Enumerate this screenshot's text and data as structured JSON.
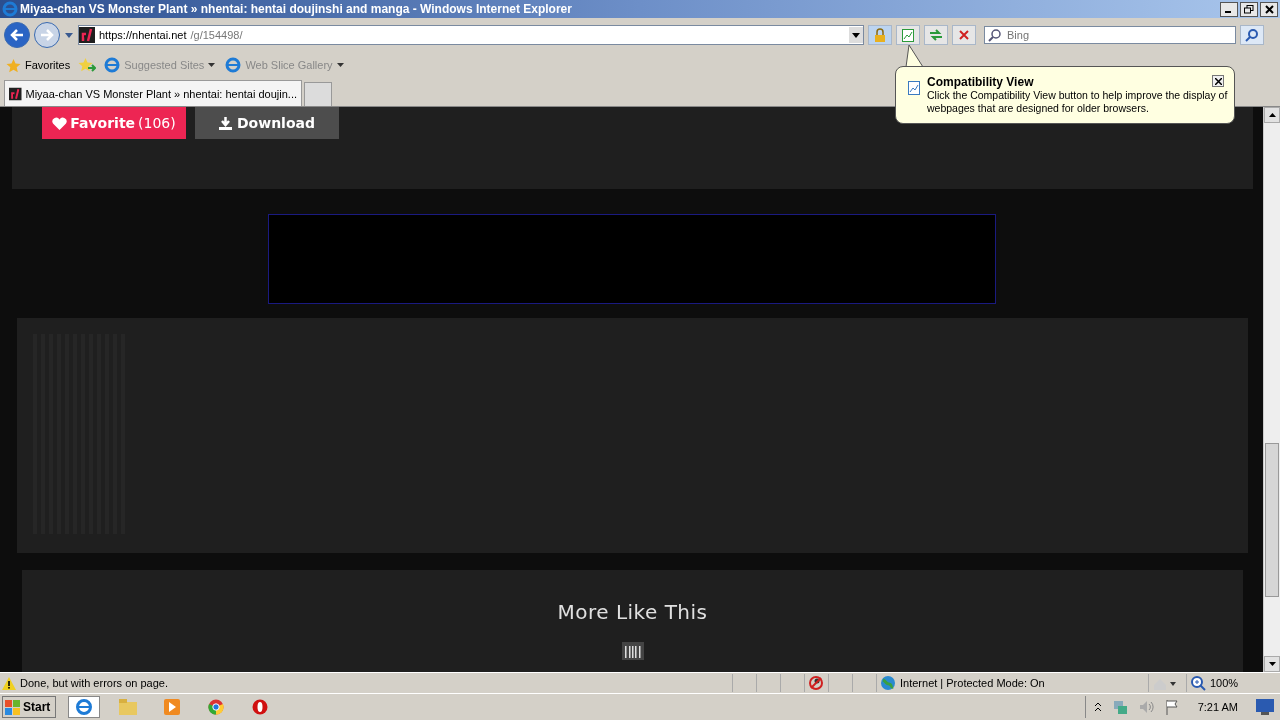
{
  "window": {
    "title": "Miyaa-chan VS Monster Plant » nhentai: hentai doujinshi and manga - Windows Internet Explorer"
  },
  "address": {
    "host": "https://nhentai.net",
    "path": "/g/154498/"
  },
  "search": {
    "placeholder": "Bing"
  },
  "favorites_bar": {
    "favorites": "Favorites",
    "items": [
      "Suggested Sites",
      "Web Slice Gallery"
    ]
  },
  "tabs": [
    {
      "label": "Miyaa-chan VS Monster Plant » nhentai: hentai doujin...",
      "selected": true
    }
  ],
  "callout": {
    "title": "Compatibility View",
    "body": "Click the Compatibility View button to help improve the display of webpages that are designed for older browsers."
  },
  "page": {
    "favorite": {
      "label": "Favorite",
      "count": "(106)"
    },
    "download": "Download",
    "section_title": "More Like This"
  },
  "status_bar": {
    "text": "Done, but with errors on page.",
    "zone": "Internet | Protected Mode: On",
    "zoom": "100%"
  },
  "taskbar": {
    "start": "Start",
    "clock": "7:21 AM"
  }
}
